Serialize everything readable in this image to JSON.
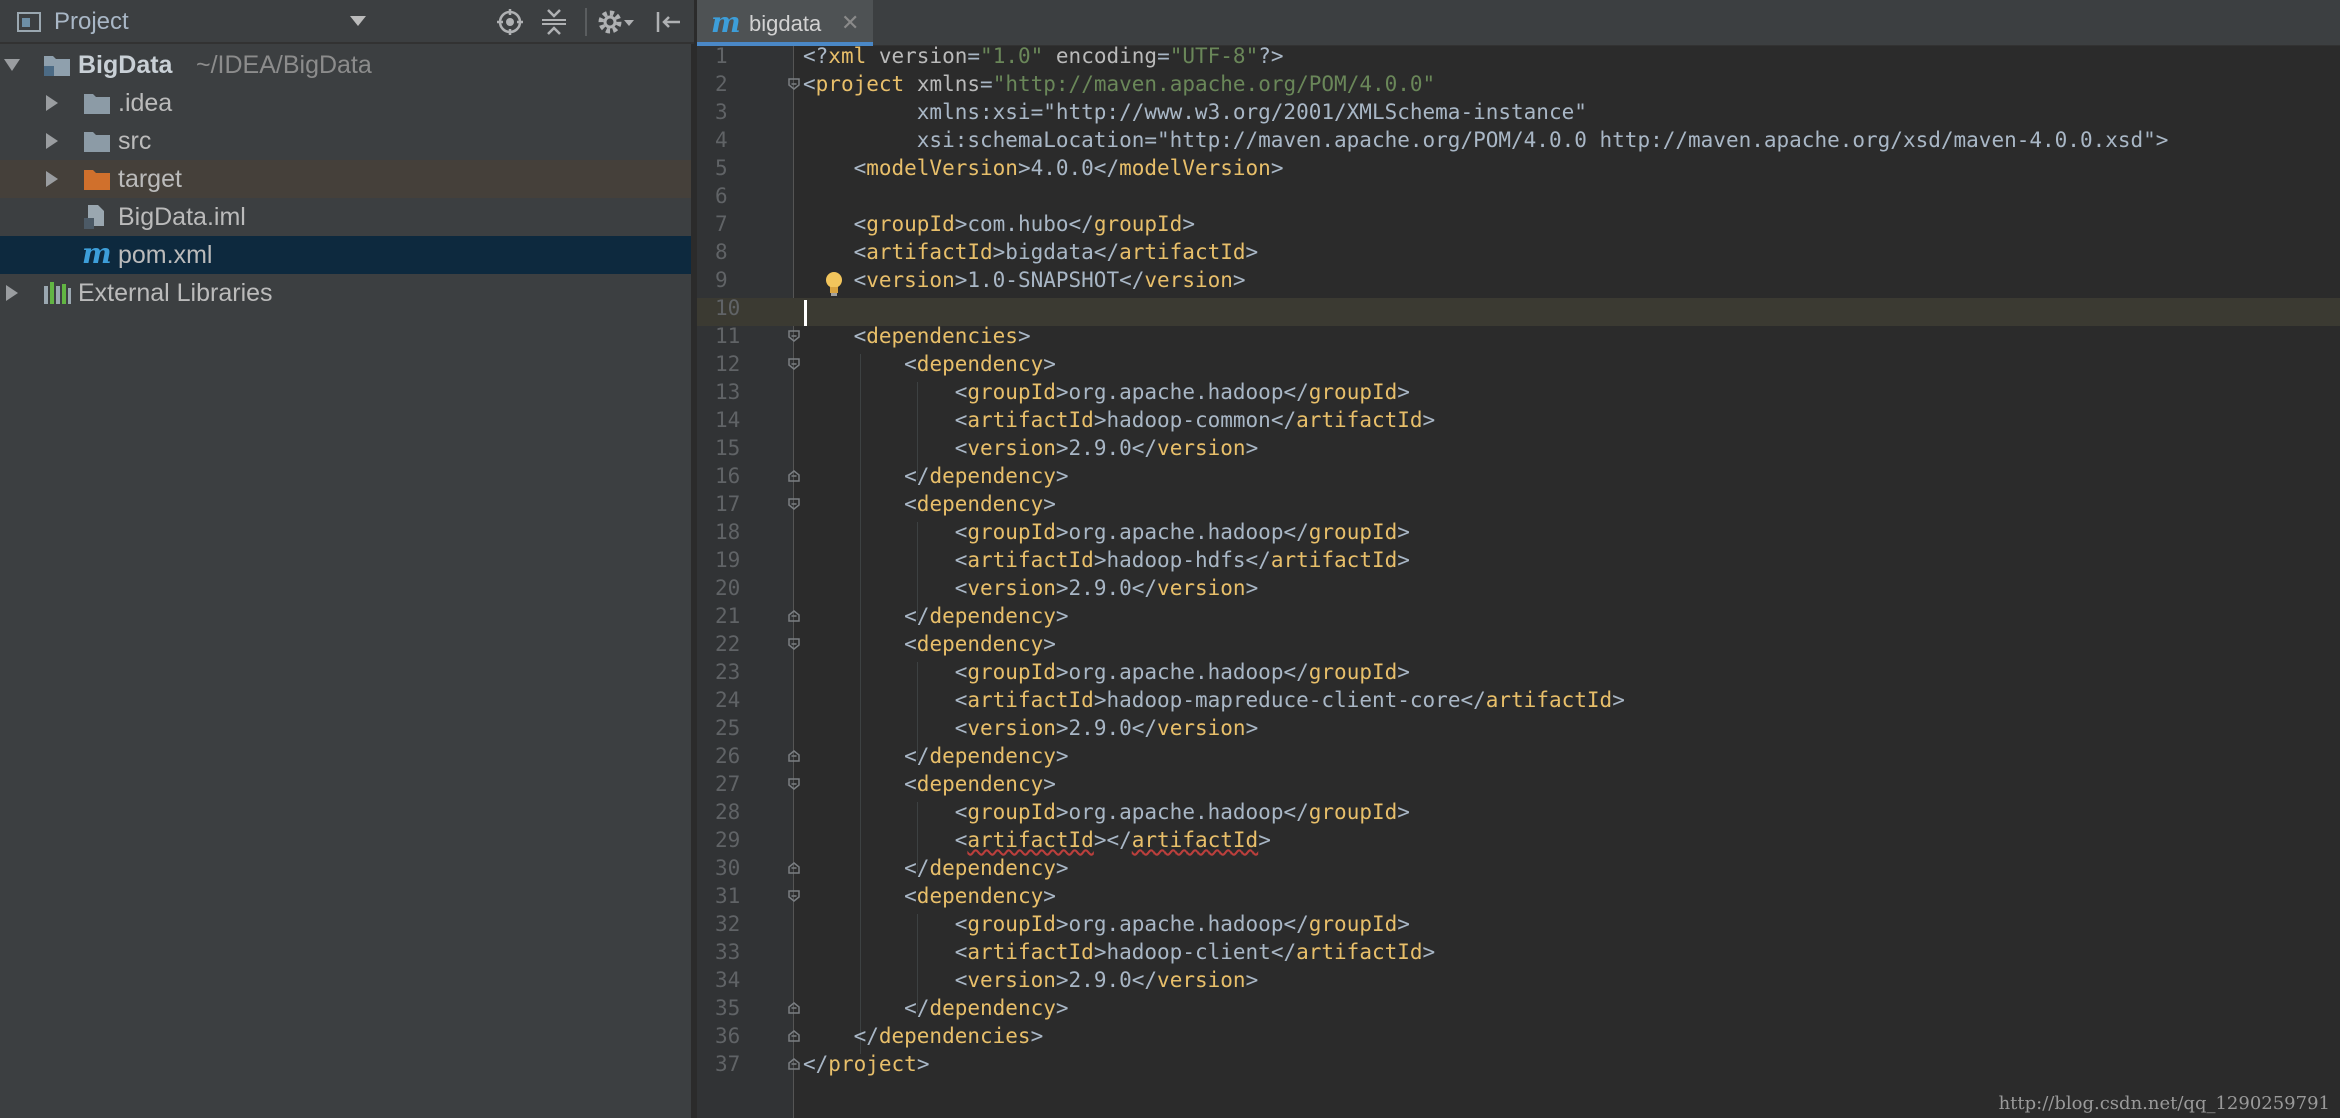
{
  "project_panel": {
    "title": "Project",
    "tree": [
      {
        "label": "BigData",
        "hint": "~/IDEA/BigData",
        "icon": "module-folder-icon"
      },
      {
        "label": ".idea",
        "icon": "folder-icon"
      },
      {
        "label": "src",
        "icon": "folder-icon"
      },
      {
        "label": "target",
        "icon": "excluded-folder-icon"
      },
      {
        "label": "BigData.iml",
        "icon": "iml-file-icon"
      },
      {
        "label": "pom.xml",
        "icon": "maven-file-icon"
      },
      {
        "label": "External Libraries",
        "icon": "libraries-icon"
      }
    ]
  },
  "editor": {
    "tab_label": "bigdata",
    "tab_icon_letter": "m",
    "maven_icon_letter": "m"
  },
  "code_lines": [
    "<?xml version=\"1.0\" encoding=\"UTF-8\"?>",
    "<project xmlns=\"http://maven.apache.org/POM/4.0.0\"",
    "         xmlns:xsi=\"http://www.w3.org/2001/XMLSchema-instance\"",
    "         xsi:schemaLocation=\"http://maven.apache.org/POM/4.0.0 http://maven.apache.org/xsd/maven-4.0.0.xsd\">",
    "    <modelVersion>4.0.0</modelVersion>",
    "",
    "    <groupId>com.hubo</groupId>",
    "    <artifactId>bigdata</artifactId>",
    "    <version>1.0-SNAPSHOT</version>",
    "",
    "    <dependencies>",
    "        <dependency>",
    "            <groupId>org.apache.hadoop</groupId>",
    "            <artifactId>hadoop-common</artifactId>",
    "            <version>2.9.0</version>",
    "        </dependency>",
    "        <dependency>",
    "            <groupId>org.apache.hadoop</groupId>",
    "            <artifactId>hadoop-hdfs</artifactId>",
    "            <version>2.9.0</version>",
    "        </dependency>",
    "        <dependency>",
    "            <groupId>org.apache.hadoop</groupId>",
    "            <artifactId>hadoop-mapreduce-client-core</artifactId>",
    "            <version>2.9.0</version>",
    "        </dependency>",
    "        <dependency>",
    "            <groupId>org.apache.hadoop</groupId>",
    "            <artifactId></artifactId>",
    "        </dependency>",
    "        <dependency>",
    "            <groupId>org.apache.hadoop</groupId>",
    "            <artifactId>hadoop-client</artifactId>",
    "            <version>2.9.0</version>",
    "        </dependency>",
    "    </dependencies>",
    "</project>"
  ],
  "line_numbers": [
    "1",
    "2",
    "3",
    "4",
    "5",
    "6",
    "7",
    "8",
    "9",
    "10",
    "11",
    "12",
    "13",
    "14",
    "15",
    "16",
    "17",
    "18",
    "19",
    "20",
    "21",
    "22",
    "23",
    "24",
    "25",
    "26",
    "27",
    "28",
    "29",
    "30",
    "31",
    "32",
    "33",
    "34",
    "35",
    "36",
    "37"
  ],
  "watermark": "http://blog.csdn.net/qq_1290259791",
  "colors": {
    "tag": "#e8bf6a",
    "attribute": "#bababa",
    "value": "#6a8759",
    "text": "#a9b7c6",
    "selection": "#0d293e",
    "accent": "#4a88c7"
  }
}
